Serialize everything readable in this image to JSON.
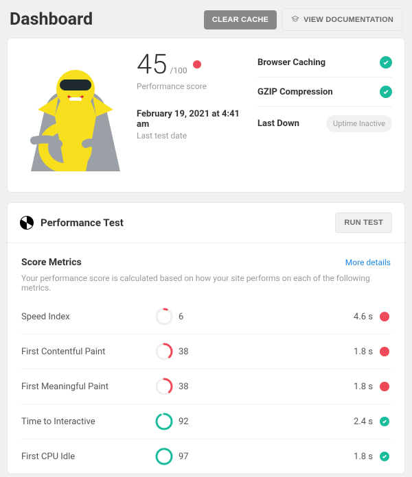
{
  "header": {
    "title": "Dashboard",
    "clear_cache": "CLEAR CACHE",
    "view_docs": "VIEW DOCUMENTATION"
  },
  "topcard": {
    "score": "45",
    "denom": "/100",
    "score_label": "Performance score",
    "test_date": "February 19, 2021 at 4:41 am",
    "test_date_label": "Last test date"
  },
  "status": {
    "browser_caching": {
      "label": "Browser Caching",
      "ok": true
    },
    "gzip": {
      "label": "GZIP Compression",
      "ok": true
    },
    "uptime": {
      "label": "Last Down",
      "pill": "Uptime Inactive"
    }
  },
  "perf": {
    "title": "Performance Test",
    "run_test": "RUN TEST"
  },
  "metrics": {
    "heading": "Score Metrics",
    "more": "More details",
    "desc": "Your performance score is calculated based on how your site performs on each of the following metrics.",
    "rows": [
      {
        "name": "Speed Index",
        "score": "6",
        "time": "4.6 s",
        "ok": false,
        "ring_pct": 6,
        "ring_color": "#ef4a59"
      },
      {
        "name": "First Contentful Paint",
        "score": "38",
        "time": "1.8 s",
        "ok": false,
        "ring_pct": 38,
        "ring_color": "#ef4a59"
      },
      {
        "name": "First Meaningful Paint",
        "score": "38",
        "time": "1.8 s",
        "ok": false,
        "ring_pct": 38,
        "ring_color": "#ef4a59"
      },
      {
        "name": "Time to Interactive",
        "score": "92",
        "time": "2.4 s",
        "ok": true,
        "ring_pct": 92,
        "ring_color": "#1abc9c"
      },
      {
        "name": "First CPU Idle",
        "score": "97",
        "time": "1.8 s",
        "ok": true,
        "ring_pct": 97,
        "ring_color": "#1abc9c"
      }
    ]
  },
  "colors": {
    "accent_green": "#1abc9c",
    "accent_red": "#ef4a59",
    "link": "#1e88e5"
  }
}
